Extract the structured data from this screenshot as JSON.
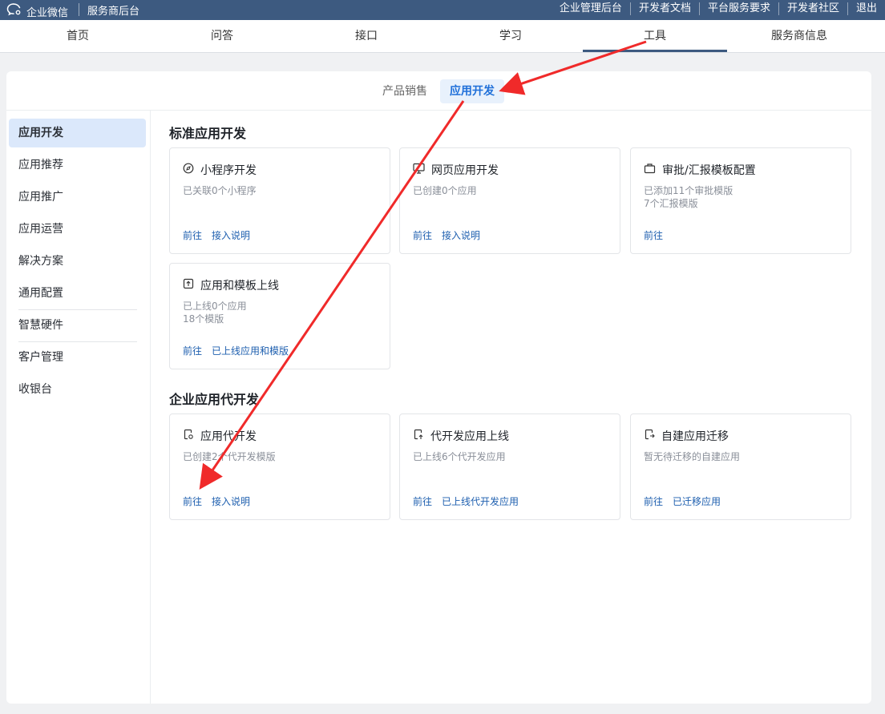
{
  "topbar": {
    "brand": "企业微信",
    "subtitle": "服务商后台",
    "links": [
      "企业管理后台",
      "开发者文档",
      "平台服务要求",
      "开发者社区",
      "退出"
    ]
  },
  "nav": {
    "items": [
      "首页",
      "问答",
      "接口",
      "学习",
      "工具",
      "服务商信息"
    ],
    "active": "工具"
  },
  "subtabs": {
    "items": [
      "产品销售",
      "应用开发"
    ],
    "active": "应用开发"
  },
  "sidebar": {
    "items": [
      "应用开发",
      "应用推荐",
      "应用推广",
      "应用运营",
      "解决方案",
      "通用配置",
      "智慧硬件",
      "客户管理",
      "收银台"
    ],
    "active": "应用开发"
  },
  "sections": [
    {
      "title": "标准应用开发",
      "cards": [
        {
          "icon": "compass-icon",
          "title": "小程序开发",
          "desc": [
            "已关联0个小程序"
          ],
          "links": [
            "前往",
            "接入说明"
          ]
        },
        {
          "icon": "monitor-icon",
          "title": "网页应用开发",
          "desc": [
            "已创建0个应用"
          ],
          "links": [
            "前往",
            "接入说明"
          ]
        },
        {
          "icon": "briefcase-icon",
          "title": "审批/汇报模板配置",
          "desc": [
            "已添加11个审批模版",
            "7个汇报模版"
          ],
          "links": [
            "前往"
          ]
        },
        {
          "icon": "upload-icon",
          "title": "应用和模板上线",
          "desc": [
            "已上线0个应用",
            "18个模版"
          ],
          "links": [
            "前往",
            "已上线应用和模版"
          ]
        }
      ]
    },
    {
      "title": "企业应用代开发",
      "cards": [
        {
          "icon": "doc-settings-icon",
          "title": "应用代开发",
          "desc": [
            "已创建2个代开发模版"
          ],
          "links": [
            "前往",
            "接入说明"
          ]
        },
        {
          "icon": "doc-upload-icon",
          "title": "代开发应用上线",
          "desc": [
            "已上线6个代开发应用"
          ],
          "links": [
            "前往",
            "已上线代开发应用"
          ]
        },
        {
          "icon": "doc-migrate-icon",
          "title": "自建应用迁移",
          "desc": [
            "暂无待迁移的自建应用"
          ],
          "links": [
            "前往",
            "已迁移应用"
          ]
        }
      ]
    }
  ],
  "colors": {
    "topbar": "#3d5a80",
    "accent": "#1e6fd9",
    "link": "#1e5faf",
    "annotation_arrow": "#f02a2a"
  }
}
